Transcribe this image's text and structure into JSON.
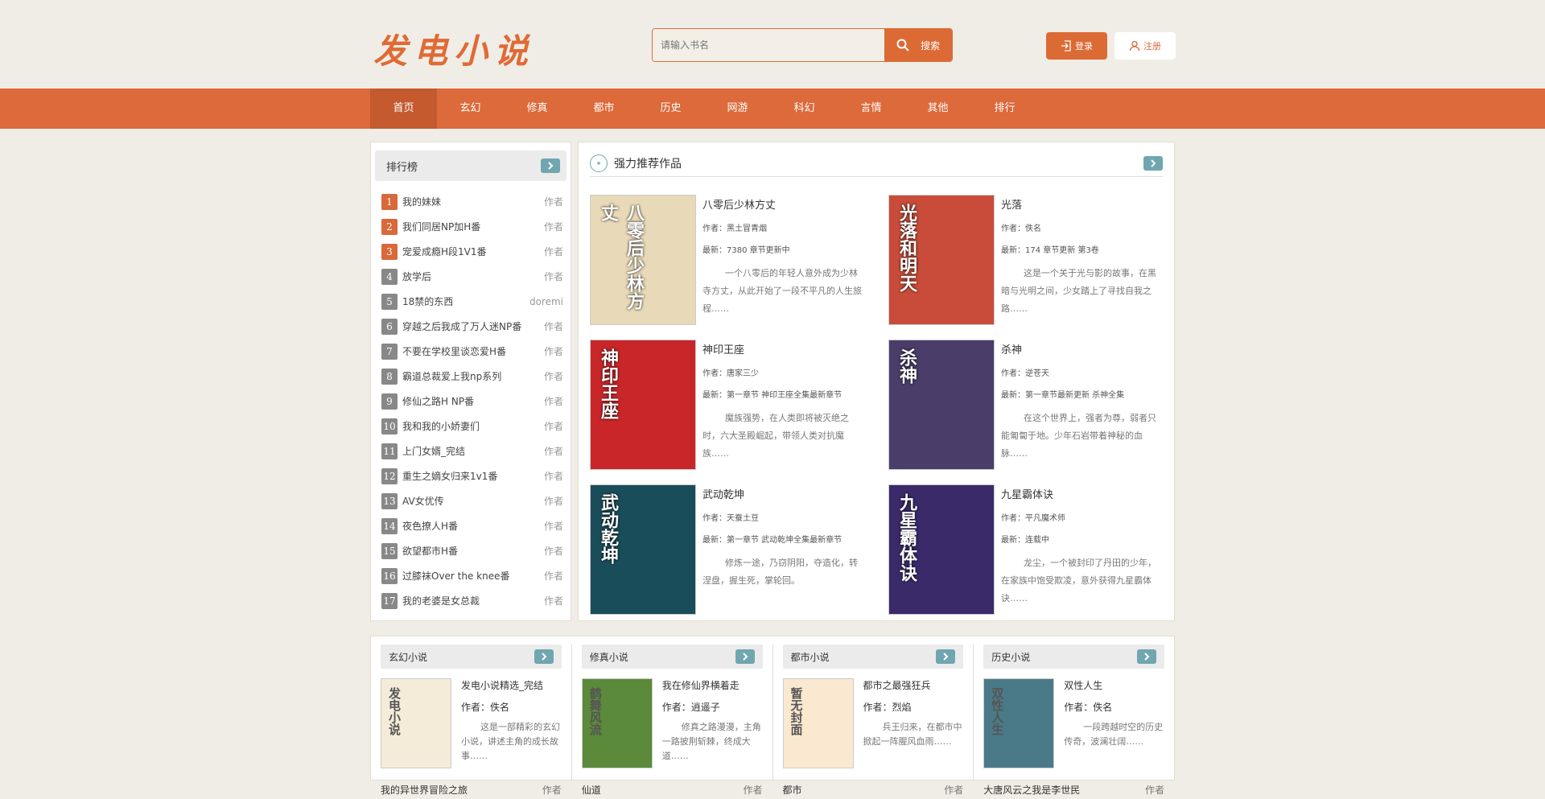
{
  "header": {
    "logo_text": "发电小说",
    "search_placeholder": "请输入书名",
    "search_button": "搜索",
    "login_label": "登录",
    "register_label": "注册"
  },
  "nav": [
    "首页",
    "玄幻",
    "修真",
    "都市",
    "历史",
    "网游",
    "科幻",
    "言情",
    "其他",
    "排行"
  ],
  "ranking": {
    "title": "排行榜",
    "items": [
      {
        "num": "1",
        "name": "我的妹妹",
        "author": "作者"
      },
      {
        "num": "2",
        "name": "我们同居NP加H番",
        "author": "作者"
      },
      {
        "num": "3",
        "name": "宠爱成瘾H段1V1番",
        "author": "作者"
      },
      {
        "num": "4",
        "name": "放学后",
        "author": "作者"
      },
      {
        "num": "5",
        "name": "18禁的东西",
        "author": "doremi"
      },
      {
        "num": "6",
        "name": "穿越之后我成了万人迷NP番",
        "author": "作者"
      },
      {
        "num": "7",
        "name": "不要在学校里谈恋爱H番",
        "author": "作者"
      },
      {
        "num": "8",
        "name": "霸道总裁爱上我np系列",
        "author": "作者"
      },
      {
        "num": "9",
        "name": "修仙之路H NP番",
        "author": "作者"
      },
      {
        "num": "10",
        "name": "我和我的小娇妻们",
        "author": "作者"
      },
      {
        "num": "11",
        "name": "上门女婿_完结",
        "author": "作者"
      },
      {
        "num": "12",
        "name": "重生之嫡女归来1v1番",
        "author": "作者"
      },
      {
        "num": "13",
        "name": "AV女优传",
        "author": "作者"
      },
      {
        "num": "14",
        "name": "夜色撩人H番",
        "author": "作者"
      },
      {
        "num": "15",
        "name": "欲望都市H番",
        "author": "作者"
      },
      {
        "num": "16",
        "name": "过膝袜Over the knee番",
        "author": "作者"
      },
      {
        "num": "17",
        "name": "我的老婆是女总裁",
        "author": "作者"
      }
    ]
  },
  "featured": {
    "title": "强力推荐作品",
    "books": [
      {
        "title": "八零后少林方丈",
        "cover_text": "八零后少林方丈",
        "cover_color": "#e8d9b8",
        "author": "作者：黑土冒青烟",
        "latest": "最新：7380 章节更新中",
        "desc": "一个八零后的年轻人意外成为少林寺方丈，从此开始了一段不平凡的人生旅程……"
      },
      {
        "title": "光落",
        "cover_text": "光落和明天",
        "cover_color": "#c94c3a",
        "author": "作者：佚名",
        "latest": "最新：174 章节更新 第3卷",
        "desc": "这是一个关于光与影的故事，在黑暗与光明之间，少女踏上了寻找自我之路……"
      },
      {
        "title": "神印王座",
        "cover_text": "神印王座",
        "cover_color": "#c9262a",
        "author": "作者：唐家三少",
        "latest": "最新：第一章节 神印王座全集最新章节",
        "desc": "魔族强势，在人类即将被灭绝之时，六大圣殿崛起，带领人类对抗魔族……"
      },
      {
        "title": "杀神",
        "cover_text": "杀神",
        "cover_color": "#4a3d6a",
        "author": "作者：逆苍天",
        "latest": "最新：第一章节最新更新 杀神全集",
        "desc": "在这个世界上，强者为尊，弱者只能匍匐于地。少年石岩带着神秘的血脉……"
      },
      {
        "title": "武动乾坤",
        "cover_text": "武动乾坤",
        "cover_color": "#1a4d5a",
        "author": "作者：天蚕土豆",
        "latest": "最新：第一章节 武动乾坤全集最新章节",
        "desc": "修炼一途，乃窃阴阳，夺造化，转涅盘，握生死，掌轮回。"
      },
      {
        "title": "九星霸体诀",
        "cover_text": "九星霸体诀",
        "cover_color": "#3a2a6a",
        "author": "作者：平凡魔术师",
        "latest": "最新：连载中",
        "desc": "龙尘，一个被封印了丹田的少年，在家族中饱受欺凌，意外获得九星霸体诀……"
      }
    ]
  },
  "categories": [
    {
      "title": "玄幻小说",
      "book_title": "发电小说精选_完结",
      "cover_text": "发电小说",
      "cover_color": "#f4ecd8",
      "author": "作者：佚名",
      "desc": "这是一部精彩的玄幻小说，讲述主角的成长故事……",
      "foot_title": "我的异世界冒险之旅",
      "foot_author": "作者"
    },
    {
      "title": "修真小说",
      "book_title": "我在修仙界横着走",
      "cover_text": "鹤舞风流",
      "cover_color": "#5a8a3a",
      "author": "作者：逍遥子",
      "desc": "修真之路漫漫，主角一路披荆斩棘，终成大道……",
      "foot_title": "仙道",
      "foot_author": "作者"
    },
    {
      "title": "都市小说",
      "book_title": "都市之最强狂兵",
      "cover_text": "暂无封面",
      "cover_color": "#fbe8d0",
      "author": "作者：烈焰",
      "desc": "兵王归来，在都市中掀起一阵腥风血雨……",
      "foot_title": "都市",
      "foot_author": "作者"
    },
    {
      "title": "历史小说",
      "book_title": "双性人生",
      "cover_text": "双性人生",
      "cover_color": "#4a7a88",
      "author": "作者：佚名",
      "desc": "一段跨越时空的历史传奇，波澜壮阔……",
      "foot_title": "大唐风云之我是李世民",
      "foot_author": "作者"
    }
  ]
}
